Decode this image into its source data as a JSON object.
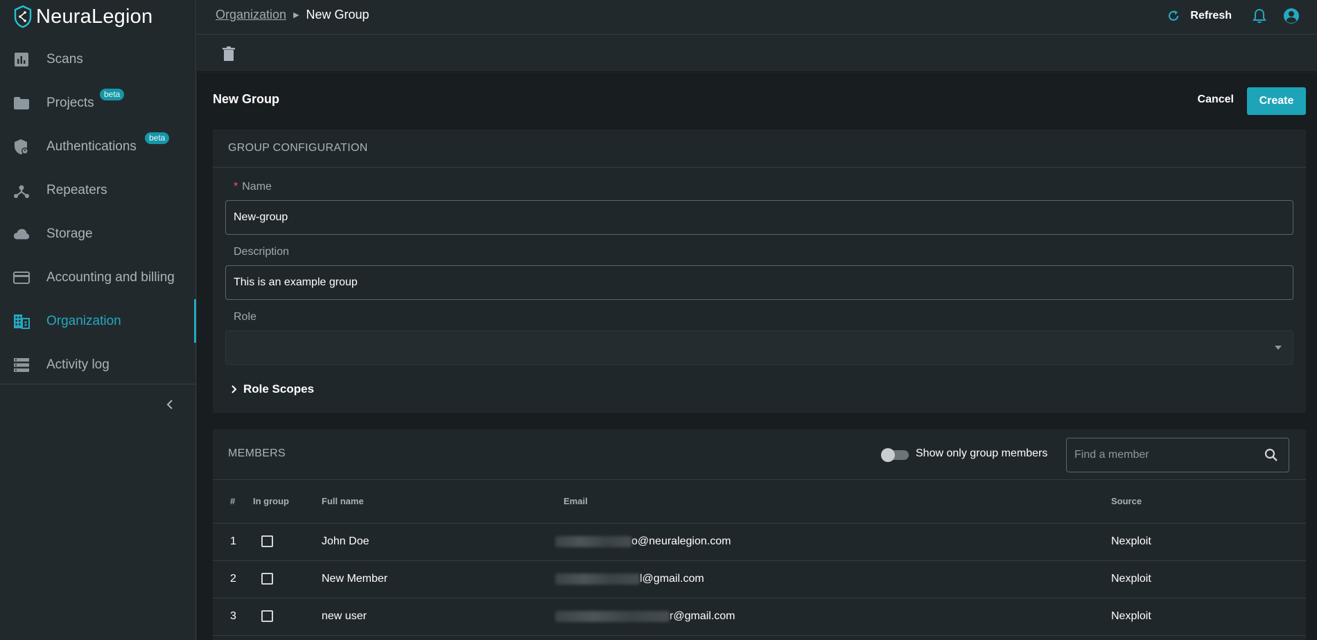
{
  "app": {
    "brand": "NeuraLegion"
  },
  "sidebar": {
    "items": [
      {
        "label": "Scans",
        "icon": "chart-icon"
      },
      {
        "label": "Projects",
        "icon": "folder-icon",
        "badge": "beta"
      },
      {
        "label": "Authentications",
        "icon": "shield-icon",
        "badge": "beta"
      },
      {
        "label": "Repeaters",
        "icon": "hub-icon"
      },
      {
        "label": "Storage",
        "icon": "cloud-icon"
      },
      {
        "label": "Accounting and billing",
        "icon": "credit-card-icon"
      },
      {
        "label": "Organization",
        "icon": "building-icon",
        "active": true
      },
      {
        "label": "Activity log",
        "icon": "list-icon"
      }
    ]
  },
  "header": {
    "breadcrumb": {
      "parent": "Organization",
      "current": "New Group"
    },
    "refresh_label": "Refresh"
  },
  "page": {
    "title": "New Group",
    "cancel_label": "Cancel",
    "create_label": "Create"
  },
  "config": {
    "section_title": "GROUP CONFIGURATION",
    "name_label": "Name",
    "name_value": "New-group",
    "description_label": "Description",
    "description_value": "This is an example group",
    "role_label": "Role",
    "role_value": "",
    "scopes_label": "Role Scopes"
  },
  "members": {
    "section_title": "MEMBERS",
    "toggle_label": "Show only group members",
    "search_placeholder": "Find a member",
    "columns": [
      "#",
      "In group",
      "Full name",
      "Email",
      "Source"
    ],
    "rows": [
      {
        "num": "1",
        "name": "John Doe",
        "email_visible": "o@neuralegion.com",
        "source": "Nexploit"
      },
      {
        "num": "2",
        "name": "New Member",
        "email_visible": "l@gmail.com",
        "source": "Nexploit"
      },
      {
        "num": "3",
        "name": "new user",
        "email_visible": "r@gmail.com",
        "source": "Nexploit"
      }
    ]
  },
  "colors": {
    "accent": "#24a9c0",
    "primary_button": "#1ea4b8",
    "required": "#ff4f6e"
  }
}
